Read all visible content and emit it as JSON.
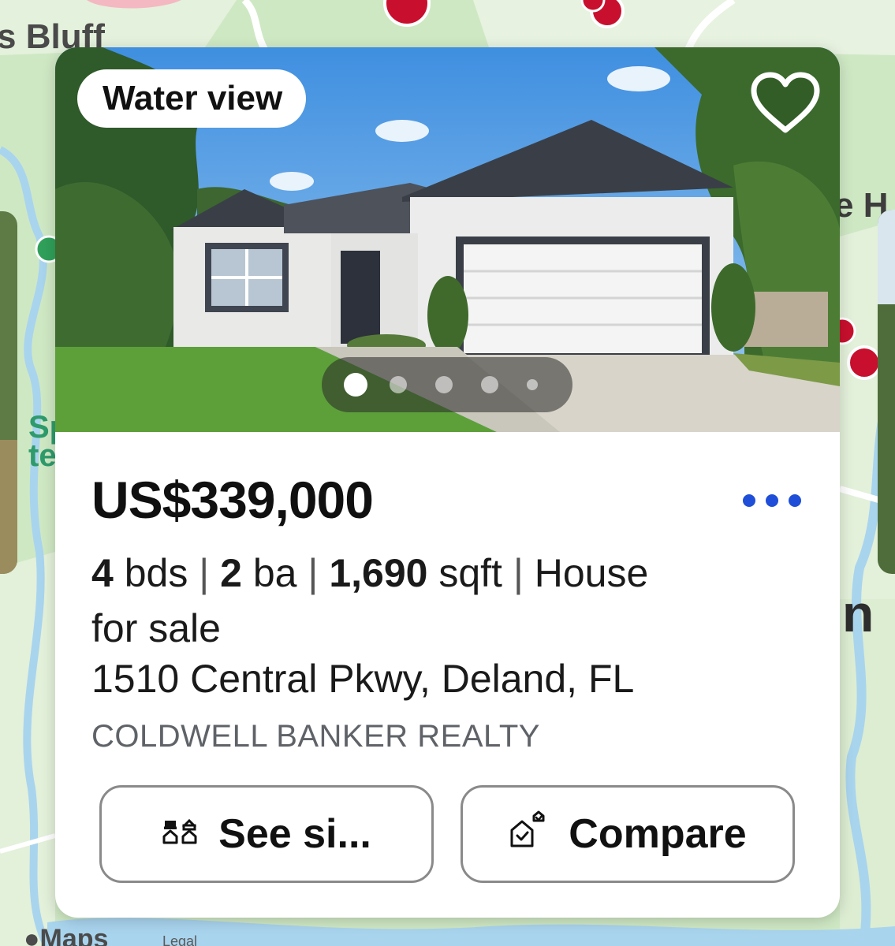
{
  "map": {
    "labels": {
      "bluff": "s Bluff",
      "sp_top": "Sp",
      "sp_bottom": "te",
      "right_h": "e H",
      "right_n": "n"
    },
    "attribution": "Maps",
    "legal": "Legal"
  },
  "listing": {
    "badge": "Water view",
    "favorite_icon": "heart-outline-icon",
    "photo_count": 5,
    "active_photo": 0,
    "price": "US$339,000",
    "more_icon": "ellipsis-icon",
    "beds_value": "4",
    "beds_unit": "bds",
    "baths_value": "2",
    "baths_unit": "ba",
    "sqft_value": "1,690",
    "sqft_unit": "sqft",
    "type_line1": "House",
    "type_line2": "for sale",
    "separator": "|",
    "address": "1510 Central Pkwy, Deland, FL",
    "broker": "COLDWELL BANKER REALTY"
  },
  "actions": {
    "similar_label": "See si...",
    "similar_icon": "similar-homes-icon",
    "compare_label": "Compare",
    "compare_icon": "compare-home-icon"
  },
  "colors": {
    "map_green": "#cfe8c4",
    "water_blue": "#a9d4ee",
    "accent_blue": "#1f4fd8",
    "pin_red": "#c8102e"
  }
}
